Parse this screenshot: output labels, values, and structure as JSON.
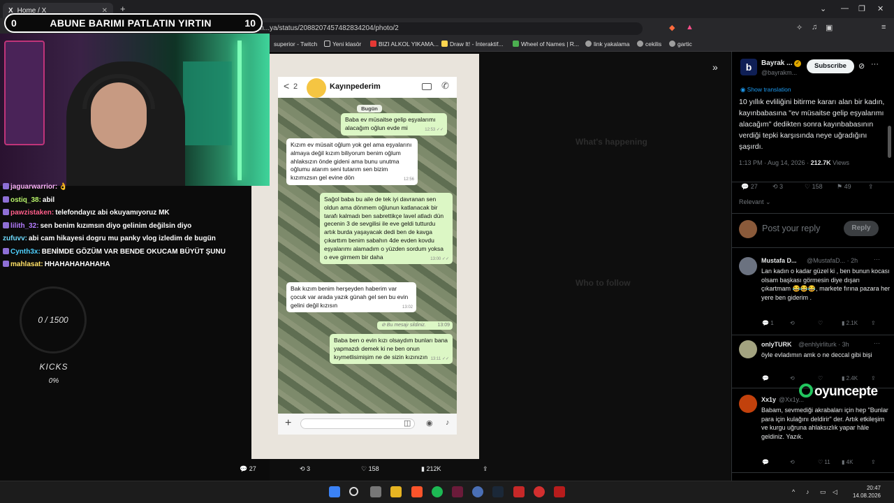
{
  "browser": {
    "tab_title": "Home / X",
    "tab_logo": "X",
    "tab_close": "✕",
    "new_tab": "+",
    "url": "x.com/bayrakm...ya/status/2088207457482834204/photo/2",
    "controls": [
      "⌄",
      "—",
      "❐",
      "✕"
    ],
    "bookmarks": [
      "superior - Twitch",
      "Yeni klasör",
      "BIZI ALKOL YIKAMA...",
      "Draw It! - İnteraktif...",
      "Wheel of Names | R...",
      "link yakalama",
      "cekilis",
      "gartic"
    ]
  },
  "stream": {
    "left_counter": "0",
    "title": "ABUNE BARIMI PATLATIN YIRTIN",
    "right_counter": "10",
    "goal": "0 / 1500",
    "kicks_label": "KICKS",
    "kicks_pct": "0%",
    "chat": [
      {
        "user": "jaguarwarrior:",
        "msg": "👌",
        "color": "#ffb3ff"
      },
      {
        "user": "ostiq_38:",
        "msg": "abil",
        "color": "#b8f36a"
      },
      {
        "user": "pawzistaken:",
        "msg": "telefondayız abi okuyamıyoruz MK",
        "color": "#ff5e8a"
      },
      {
        "user": "lilith_32:",
        "msg": "sen benim kızımsın diyo gelinim değilsin diyo",
        "color": "#b57cff"
      },
      {
        "user": "zufuvv:",
        "msg": "abi cam hikayesi dogru mu panky vlog izledim de bugün",
        "color": "#6fdcff"
      },
      {
        "user": "Cynth3x:",
        "msg": "BENİMDE GÖZÜM VAR BENDE OKUCAM BÜYÜT ŞUNU",
        "color": "#4fd1ff"
      },
      {
        "user": "mahlasat:",
        "msg": "HHAHAHAHAHAHA",
        "color": "#ffe066"
      }
    ]
  },
  "whatsapp": {
    "back": "<",
    "unread": "2",
    "contact": "Kayınpederim",
    "date": "Bugün",
    "msg1": {
      "text": "Baba ev müsaitse gelip eşyalarımı alacağım oğlun evde mi",
      "time": "12:53 ✓✓"
    },
    "msg2": {
      "text": "Kızım ev müsait oğlum yok gel ama eşyalarını almaya değil kızım biliyorum benim oğlum ahlaksızın önde gideni ama bunu unutma oğlumu atarım seni tutarım sen bizim kızımızsın gel evine dön",
      "time": "12:56"
    },
    "msg3": {
      "text": "Sağol baba bu aile de tek iyi davranan sen oldun ama dönmem oğlunun katlanacak bir tarafı kalmadı ben sabrettikçe lavel atladı dün gecenin 3 de sevgilisi ile eve geldi tutturdu artık burda yaşayacak dedi ben de kavga çıkarttım benim sabahın 4de evden kovdu eşyalarımı alamadım o yüzden sordum yoksa o eve girmem bir daha",
      "time": "13:00 ✓✓"
    },
    "msg4": {
      "text": "Bak kızım benim herşeyden haberim var çocuk var arada yazık günah gel sen bu evin gelini değil kızısın",
      "time": "13:02"
    },
    "deleted": "⊘ Bu mesajı sildiniz.",
    "deleted_time": "13:09",
    "msg5": {
      "text": "Baba ben o evin kızı olsaydım bunları bana yapmazdı demek ki ne ben onun kıymetlisimişim ne de sizin kızınızın",
      "time": "13:11 ✓✓"
    }
  },
  "photo_actions": {
    "replies": "27",
    "reposts": "3",
    "likes": "158",
    "views": "212K"
  },
  "tweet": {
    "author": "Bayrak ...",
    "handle": "@bayrakm...",
    "subscribe": "Subscribe",
    "show_translation": "Show translation",
    "text": "10 yıllık evliliğini bitirme kararı alan bir kadın, kayınbabasına \"ev müsaitse gelip eşyalarımı alacağım\" dedikten sonra kayınbabasının verdiği tepki karşısında neye uğradığını şaşırdı.",
    "time": "1:13 PM · Aug 14, 2026 · ",
    "views_count": "212.7K",
    "views_label": " Views",
    "replies": "27",
    "reposts": "3",
    "likes": "158",
    "bookmarks": "49",
    "sort": "Relevant",
    "reply_placeholder": "Post your reply",
    "reply_button": "Reply"
  },
  "replies": [
    {
      "name": "Mustafa D...",
      "handle": "@MustafaD... · 2h",
      "text": "Lan kadın o kadar güzel ki , ben bunun kocası olsam başkası görmesin diye dışarı çıkartmam 😂😂😂, markete fırına pazara her yere ben giderim .",
      "replies": "1",
      "likes": "",
      "views": "2.1K"
    },
    {
      "name": "onlyTURK",
      "handle": "@enhlyirliturk · 3h",
      "text": "öyle evladımın amk o ne deccal gibi bişi",
      "replies": "",
      "likes": "",
      "views": "2.4K"
    },
    {
      "name": "Xx1y",
      "handle": "@Xx1y...",
      "text": "Babam, sevmediği akrabaları için hep \"Bunlar para için kulağını deldirir\" der. Artık etkileşim ve kurgu uğruna ahlaksızlık yapar hâle geldiniz. Yazık.",
      "replies": "",
      "likes": "11",
      "views": "4K"
    }
  ],
  "watermark": "oyuncepte",
  "clock": {
    "time": "20:47",
    "date": "14.08.2026"
  },
  "colors": {
    "x_blue": "#1d9bf0",
    "accent_green": "#22c55e"
  }
}
